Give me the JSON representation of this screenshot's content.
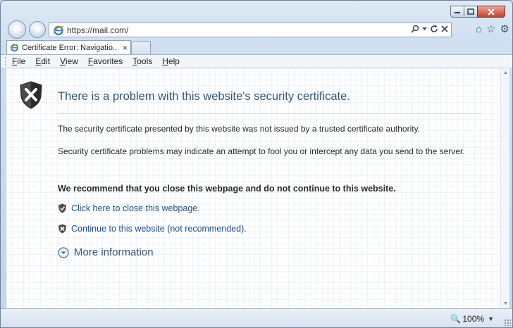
{
  "window": {
    "caption_buttons": {
      "minimize_icon": "minimize-icon",
      "maximize_icon": "maximize-icon",
      "close_icon": "close-icon"
    }
  },
  "navigation": {
    "back_icon": "back-arrow-icon",
    "forward_icon": "forward-arrow-icon",
    "address_url": "https://mail.com/",
    "address_tools": [
      "search-icon",
      "dropdown-icon",
      "refresh-icon",
      "stop-icon"
    ],
    "right_icons": [
      "home-icon",
      "favorites-star-icon",
      "gear-icon"
    ]
  },
  "tabs": [
    {
      "label": "Certificate Error: Navigatio...",
      "close": "×",
      "active": true
    }
  ],
  "menubar": {
    "items": [
      {
        "label": "File",
        "mnemonic": "F",
        "rest": "ile"
      },
      {
        "label": "Edit",
        "mnemonic": "E",
        "rest": "dit"
      },
      {
        "label": "View",
        "mnemonic": "V",
        "rest": "iew"
      },
      {
        "label": "Favorites",
        "mnemonic": "F",
        "rest": "avorites",
        "mnemonic_pos": 0
      },
      {
        "label": "Tools",
        "mnemonic": "T",
        "rest": "ools"
      },
      {
        "label": "Help",
        "mnemonic": "H",
        "rest": "elp"
      }
    ]
  },
  "page": {
    "heading": "There is a problem with this website's security certificate.",
    "para1": "The security certificate presented by this website was not issued by a trusted certificate authority.",
    "para2": "Security certificate problems may indicate an attempt to fool you or intercept any data you send to the server.",
    "recommend": "We recommend that you close this webpage and do not continue to this website.",
    "close_link": "Click here to close this webpage.",
    "continue_link": "Continue to this website (not recommended).",
    "more_info": "More information"
  },
  "statusbar": {
    "zoom": "100%"
  },
  "colors": {
    "heading": "#36557a",
    "link": "#1e4f8c",
    "shield_dark": "#3a3a3a",
    "close_button": "#c4402e"
  }
}
